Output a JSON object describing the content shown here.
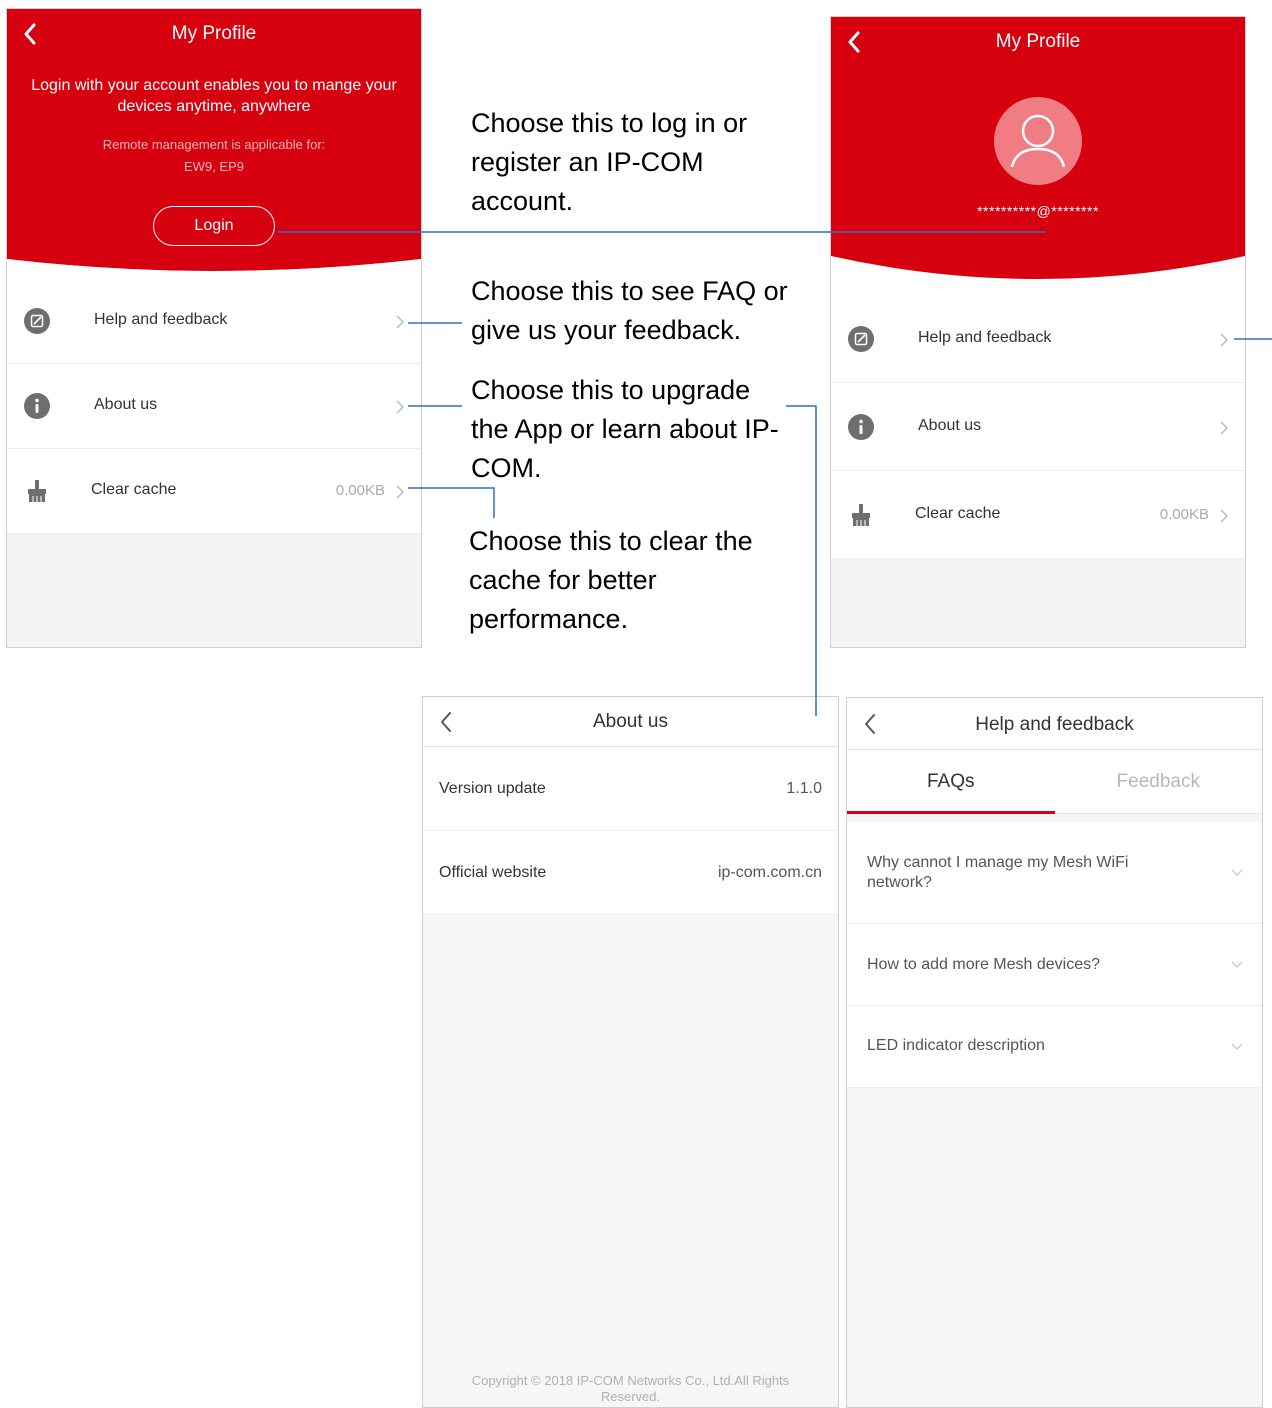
{
  "profile_guest": {
    "title": "My Profile",
    "login_message": "Login with your account enables you to mange your devices anytime, anywhere",
    "remote_note_line1": "Remote management is applicable for:",
    "remote_note_line2": "EW9, EP9",
    "login_button": "Login",
    "menu": [
      {
        "label": "Help and feedback",
        "icon": "edit-icon"
      },
      {
        "label": "About us",
        "icon": "info-icon"
      },
      {
        "label": "Clear cache",
        "icon": "broom-icon",
        "value": "0.00KB"
      }
    ]
  },
  "profile_user": {
    "title": "My Profile",
    "email": "**********@********",
    "menu": [
      {
        "label": "Help and feedback",
        "icon": "edit-icon"
      },
      {
        "label": "About us",
        "icon": "info-icon"
      },
      {
        "label": "Clear cache",
        "icon": "broom-icon",
        "value": "0.00KB"
      }
    ]
  },
  "about": {
    "title": "About us",
    "rows": [
      {
        "label": "Version update",
        "value": "1.1.0"
      },
      {
        "label": "Official website",
        "value": "ip-com.com.cn"
      }
    ],
    "copyright": "Copyright © 2018 IP-COM Networks Co., Ltd.All Rights Reserved."
  },
  "help": {
    "title": "Help and feedback",
    "tabs": [
      "FAQs",
      "Feedback"
    ],
    "faqs": [
      "Why cannot I manage my Mesh WiFi network?",
      "How to add more Mesh devices?",
      "LED indicator description"
    ]
  },
  "annotations": {
    "login": "Choose this to log in or register an IP-COM account.",
    "help": "Choose this to see FAQ or give us your feedback.",
    "about": "Choose this to upgrade the App or learn about IP-COM.",
    "cache": "Choose this to clear the cache for better performance."
  },
  "colors": {
    "brand_red": "#d7000f",
    "annotation_line": "#2f6fc4"
  }
}
